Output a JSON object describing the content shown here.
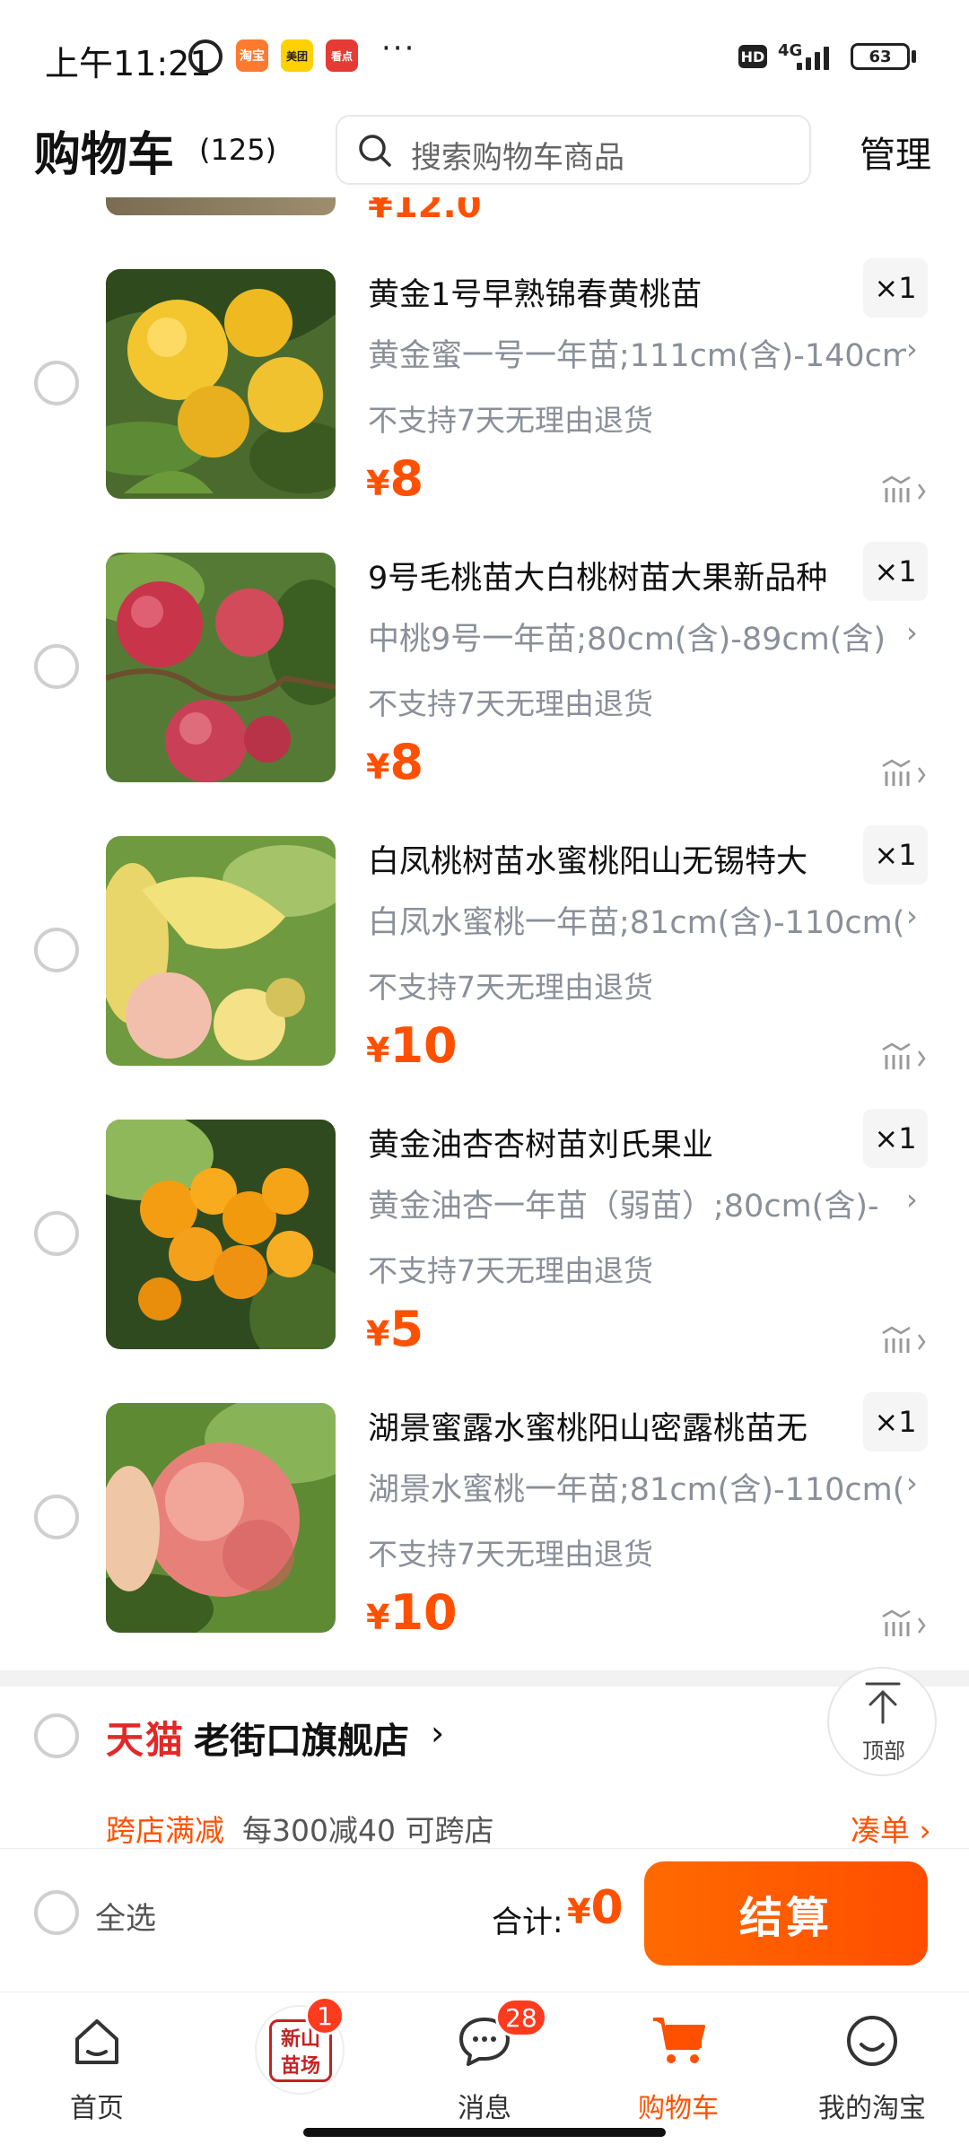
{
  "status_bar": {
    "time": "上午11:21",
    "app_icons": [
      "淘宝",
      "美团",
      "看点"
    ],
    "more": "···",
    "hd": "HD",
    "network": "4G",
    "battery": "63"
  },
  "header": {
    "title": "购物车",
    "count": "(125)",
    "search_placeholder": "搜索购物车商品",
    "manage": "管理"
  },
  "items": [
    {
      "title": "黄金1号早熟锦春黄桃苗",
      "qty": "×1",
      "sku": "黄金蜜一号一年苗;111cm(含)-140cm",
      "policy": "不支持7天无理由退货",
      "price_symbol": "¥",
      "price": "8",
      "image": "golden-peach-photo"
    },
    {
      "title": "9号毛桃苗大白桃树苗大果新品种",
      "qty": "×1",
      "sku": "中桃9号一年苗;80cm(含)-89cm(含)",
      "policy": "不支持7天无理由退货",
      "price_symbol": "¥",
      "price": "8",
      "image": "red-peach-photo"
    },
    {
      "title": "白凤桃树苗水蜜桃阳山无锡特大",
      "qty": "×1",
      "sku": "白凤水蜜桃一年苗;81cm(含)-110cm(",
      "policy": "不支持7天无理由退货",
      "price_symbol": "¥",
      "price": "10",
      "image": "white-peach-photo"
    },
    {
      "title": "黄金油杏杏树苗刘氏果业",
      "qty": "×1",
      "sku": "黄金油杏一年苗（弱苗）;80cm(含)-",
      "policy": "不支持7天无理由退货",
      "price_symbol": "¥",
      "price": "5",
      "image": "apricot-photo"
    },
    {
      "title": "湖景蜜露水蜜桃阳山密露桃苗无",
      "qty": "×1",
      "sku": "湖景水蜜桃一年苗;81cm(含)-110cm(",
      "policy": "不支持7天无理由退货",
      "price_symbol": "¥",
      "price": "10",
      "image": "honey-peach-photo"
    }
  ],
  "shop": {
    "brand": "天猫",
    "name": "老街口旗舰店",
    "promo_tag": "跨店满减",
    "promo_text": "每300减40 可跨店",
    "promo_link": "凑单"
  },
  "back_to_top": "顶部",
  "checkout": {
    "select_all": "全选",
    "total_label": "合计:",
    "total_symbol": "¥",
    "total_value": "0",
    "button": "结算"
  },
  "tabs": [
    {
      "label": "首页",
      "icon": "home-icon"
    },
    {
      "label": "新山苗场",
      "icon": "xinshan-logo",
      "badge": "1"
    },
    {
      "label": "消息",
      "icon": "message-icon",
      "badge": "28"
    },
    {
      "label": "购物车",
      "icon": "cart-icon",
      "active": true
    },
    {
      "label": "我的淘宝",
      "icon": "smile-icon"
    }
  ],
  "colors": {
    "accent": "#ff5000",
    "tmall_red": "#e22828",
    "secondary_text": "#8a8f99"
  }
}
